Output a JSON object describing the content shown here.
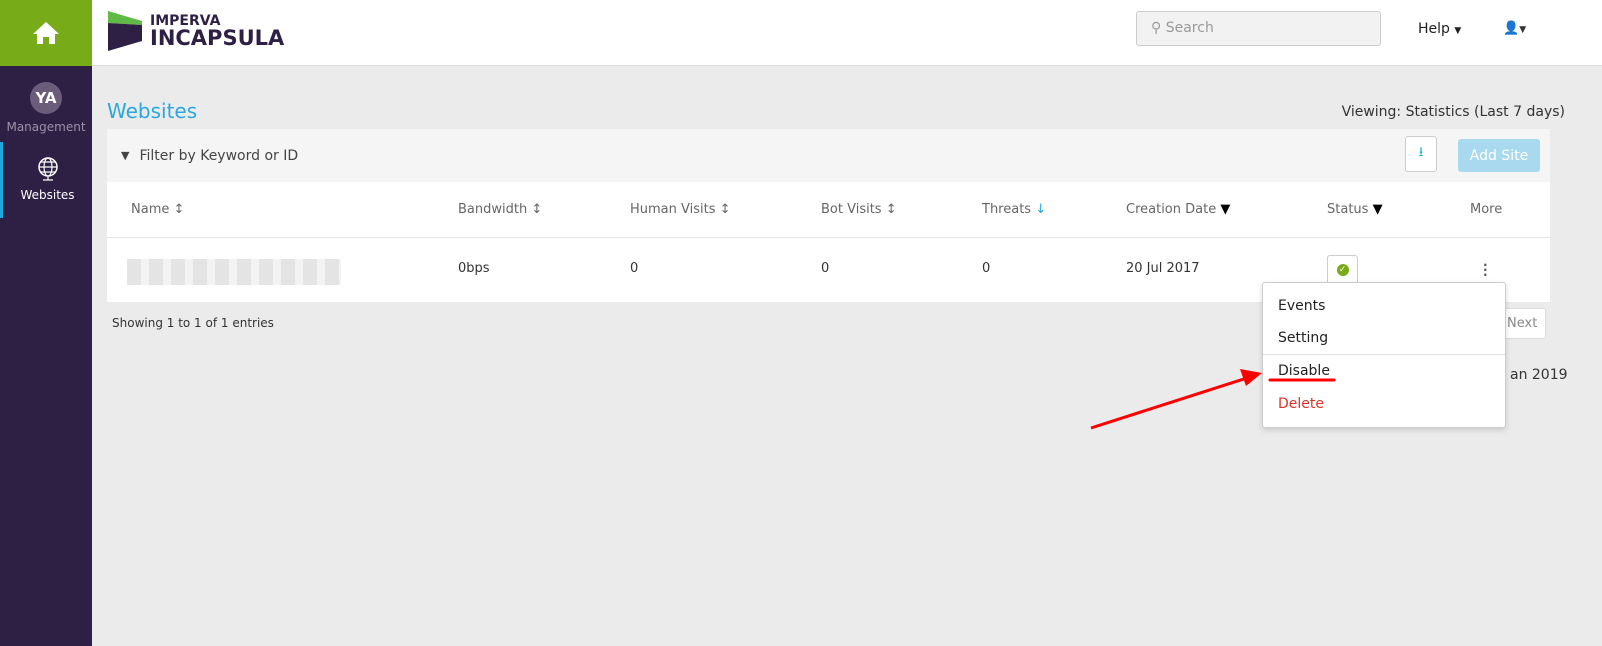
{
  "sidebar": {
    "items": [
      {
        "initials": "YA",
        "label": "Management"
      },
      {
        "label": "Websites"
      }
    ]
  },
  "header": {
    "logo_top": "IMPERVA",
    "logo_bottom": "INCAPSULA",
    "search_placeholder": "Search",
    "help_label": "Help"
  },
  "page": {
    "title": "Websites",
    "viewing": "Viewing: Statistics (Last 7 days)",
    "filter_label": "Filter by Keyword or ID",
    "add_site": "Add Site"
  },
  "table": {
    "columns": [
      "Name",
      "Bandwidth",
      "Human Visits",
      "Bot Visits",
      "Threats",
      "Creation Date",
      "Status",
      "More"
    ],
    "rows": [
      {
        "name": "",
        "bandwidth": "0bps",
        "human": "0",
        "bot": "0",
        "threats": "0",
        "created": "20 Jul 2017",
        "status": "active"
      }
    ]
  },
  "footer": {
    "showing": "Showing 1 to 1 of 1 entries",
    "next": "Next",
    "partial_date": "an 2019"
  },
  "menu": {
    "items": [
      "Events",
      "Setting",
      "Disable",
      "Delete"
    ]
  },
  "colors": {
    "accent": "#2aa8de",
    "brand_green": "#77ab17",
    "sidebar": "#2e1f45",
    "delete": "#d9342b",
    "annotation": "#ff0000"
  }
}
